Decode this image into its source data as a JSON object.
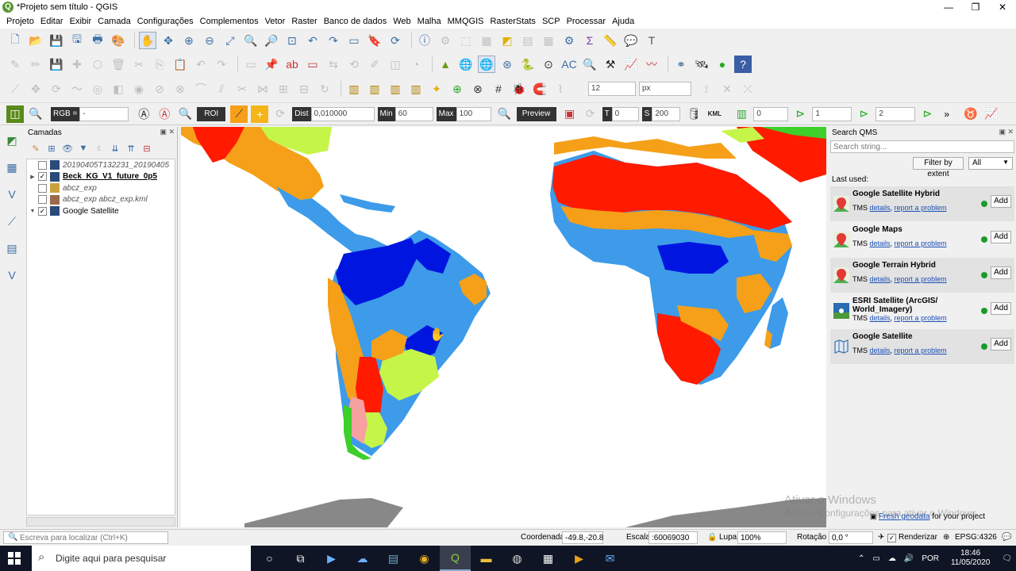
{
  "window": {
    "title": "*Projeto sem título - QGIS",
    "controls": [
      "—",
      "❐",
      "✕"
    ]
  },
  "menu": [
    "Projeto",
    "Editar",
    "Exibir",
    "Camada",
    "Configurações",
    "Complementos",
    "Vetor",
    "Raster",
    "Banco de dados",
    "Web",
    "Malha",
    "MMQGIS",
    "RasterStats",
    "SCP",
    "Processar",
    "Ajuda"
  ],
  "scp_toolbar": {
    "rgb_label": "RGB =",
    "rgb_value": "-",
    "roi_label": "ROI",
    "dist_label": "Dist",
    "dist_value": "0,010000",
    "min_label": "Min",
    "min_value": "60",
    "max_label": "Max",
    "max_value": "100",
    "preview_label": "Preview",
    "t_label": "T",
    "t_value": "0",
    "s_label": "S",
    "s_value": "200",
    "kml_label": "KML",
    "band_value_1": "0",
    "band_value_2": "1",
    "band_value_3": "2",
    "more": "»"
  },
  "digitize_toolbar": {
    "font_size": "12",
    "unit": "px"
  },
  "layers_panel": {
    "title": "Camadas",
    "items": [
      {
        "label": "20190405T132231_20190405",
        "checked": false,
        "expand": "",
        "style": "italic-grey",
        "icon_color": "#2b4a7a"
      },
      {
        "label": "Beck_KG_V1_future_0p5",
        "checked": true,
        "expand": "▶",
        "style": "bold",
        "icon_color": "#2b4a7a"
      },
      {
        "label": "abcz_exp",
        "checked": false,
        "expand": "",
        "style": "italic-grey",
        "icon_color": "#c9a23b"
      },
      {
        "label": "abcz_exp abcz_exp.kml",
        "checked": false,
        "expand": "",
        "style": "italic-grey",
        "icon_color": "#9b6a4a"
      },
      {
        "label": "Google Satellite",
        "checked": true,
        "expand": "▼",
        "style": "normal",
        "icon_color": "#2b4a7a"
      }
    ]
  },
  "qms": {
    "title": "Search QMS",
    "search_placeholder": "Search string...",
    "filter_button": "Filter by extent",
    "filter_select": "All",
    "last_used_label": "Last used:",
    "services": [
      {
        "name": "Google Satellite Hybrid",
        "type": "TMS",
        "details": "details",
        "report": "report a problem",
        "add": "Add",
        "icon": "google-maps-pin-icon"
      },
      {
        "name": "Google Maps",
        "type": "TMS",
        "details": "details",
        "report": "report a problem",
        "add": "Add",
        "icon": "google-maps-pin-icon"
      },
      {
        "name": "Google Terrain Hybrid",
        "type": "TMS",
        "details": "details",
        "report": "report a problem",
        "add": "Add",
        "icon": "google-maps-pin-icon"
      },
      {
        "name": "ESRI Satellite (ArcGIS/ World_Imagery)",
        "type": "TMS",
        "details": "details",
        "report": "report a problem",
        "add": "Add",
        "icon": "esri-globe-icon"
      },
      {
        "name": "Google Satellite",
        "type": "TMS",
        "details": "details",
        "report": "report a problem",
        "add": "Add",
        "icon": "map-fold-icon"
      }
    ],
    "fresh_link": "Fresh geodata",
    "fresh_text": " for your project"
  },
  "watermark": {
    "line1": "Ativar o Windows",
    "line2": "Acesse Configurações para ativar o Windows."
  },
  "statusbar": {
    "locator_placeholder": "Escreva para localizar (Ctrl+K)",
    "coord_label": "Coordenada",
    "coord_value": "-49.8,-20.8",
    "scale_label": "Escala",
    "scale_value": ":60069030",
    "magnifier_label": "Lupa",
    "magnifier_value": "100%",
    "rotation_label": "Rotação",
    "rotation_value": "0,0 °",
    "render_label": "Renderizar",
    "crs": "EPSG:4326"
  },
  "taskbar": {
    "search_placeholder": "Digite aqui para pesquisar",
    "language": "POR",
    "time": "18:46",
    "date": "11/05/2020"
  },
  "colors": {
    "koppen_red": "#ff1a00",
    "koppen_orange": "#f5a018",
    "koppen_light_blue": "#3d9be9",
    "koppen_dark_blue": "#0016e0",
    "koppen_lime": "#c6f54a",
    "koppen_green": "#3dcf2a",
    "koppen_pink": "#f7a0a0"
  }
}
